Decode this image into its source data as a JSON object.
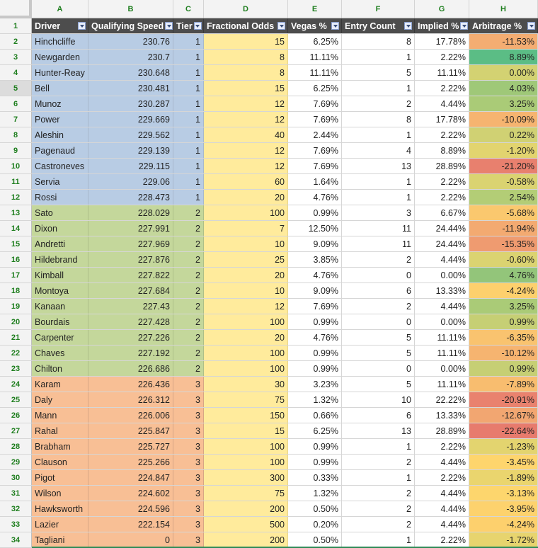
{
  "columns": [
    "A",
    "B",
    "C",
    "D",
    "E",
    "F",
    "G",
    "H"
  ],
  "headers": [
    "Driver",
    "Qualifying Speed",
    "Tier",
    "Fractional Odds",
    "Vegas %",
    "Entry Count",
    "Implied %",
    "Arbitrage %"
  ],
  "selected_row": 5,
  "tier_colors": {
    "1": "#b8cce4",
    "2": "#c4d79b",
    "3": "#f8bf95"
  },
  "odds_color": "#ffeb9c",
  "rows": [
    {
      "n": 2,
      "driver": "Hinchcliffe",
      "speed": "230.76",
      "tier": "1",
      "odds": "15",
      "vegas": "6.25%",
      "entry": "8",
      "implied": "17.78%",
      "arb": "-11.53%",
      "arb_color": "#f4ad72"
    },
    {
      "n": 3,
      "driver": "Newgarden",
      "speed": "230.7",
      "tier": "1",
      "odds": "8",
      "vegas": "11.11%",
      "entry": "1",
      "implied": "2.22%",
      "arb": "8.89%",
      "arb_color": "#5bbd85"
    },
    {
      "n": 4,
      "driver": "Hunter-Reay",
      "speed": "230.648",
      "tier": "1",
      "odds": "8",
      "vegas": "11.11%",
      "entry": "5",
      "implied": "11.11%",
      "arb": "0.00%",
      "arb_color": "#d3d272"
    },
    {
      "n": 5,
      "driver": "Bell",
      "speed": "230.481",
      "tier": "1",
      "odds": "15",
      "vegas": "6.25%",
      "entry": "1",
      "implied": "2.22%",
      "arb": "4.03%",
      "arb_color": "#9fc878"
    },
    {
      "n": 6,
      "driver": "Munoz",
      "speed": "230.287",
      "tier": "1",
      "odds": "12",
      "vegas": "7.69%",
      "entry": "2",
      "implied": "4.44%",
      "arb": "3.25%",
      "arb_color": "#aacb77"
    },
    {
      "n": 7,
      "driver": "Power",
      "speed": "229.669",
      "tier": "1",
      "odds": "12",
      "vegas": "7.69%",
      "entry": "8",
      "implied": "17.78%",
      "arb": "-10.09%",
      "arb_color": "#f6b470"
    },
    {
      "n": 8,
      "driver": "Aleshin",
      "speed": "229.562",
      "tier": "1",
      "odds": "40",
      "vegas": "2.44%",
      "entry": "1",
      "implied": "2.22%",
      "arb": "0.22%",
      "arb_color": "#d0d173"
    },
    {
      "n": 9,
      "driver": "Pagenaud",
      "speed": "229.139",
      "tier": "1",
      "odds": "12",
      "vegas": "7.69%",
      "entry": "4",
      "implied": "8.89%",
      "arb": "-1.20%",
      "arb_color": "#e2d46f"
    },
    {
      "n": 10,
      "driver": "Castroneves",
      "speed": "229.115",
      "tier": "1",
      "odds": "12",
      "vegas": "7.69%",
      "entry": "13",
      "implied": "28.89%",
      "arb": "-21.20%",
      "arb_color": "#e8806e"
    },
    {
      "n": 11,
      "driver": "Servia",
      "speed": "229.06",
      "tier": "1",
      "odds": "60",
      "vegas": "1.64%",
      "entry": "1",
      "implied": "2.22%",
      "arb": "-0.58%",
      "arb_color": "#dad371"
    },
    {
      "n": 12,
      "driver": "Rossi",
      "speed": "228.473",
      "tier": "1",
      "odds": "20",
      "vegas": "4.76%",
      "entry": "1",
      "implied": "2.22%",
      "arb": "2.54%",
      "arb_color": "#b3cd76"
    },
    {
      "n": 13,
      "driver": "Sato",
      "speed": "228.029",
      "tier": "2",
      "odds": "100",
      "vegas": "0.99%",
      "entry": "3",
      "implied": "6.67%",
      "arb": "-5.68%",
      "arb_color": "#fac86e"
    },
    {
      "n": 14,
      "driver": "Dixon",
      "speed": "227.991",
      "tier": "2",
      "odds": "7",
      "vegas": "12.50%",
      "entry": "11",
      "implied": "24.44%",
      "arb": "-11.94%",
      "arb_color": "#f3aa71"
    },
    {
      "n": 15,
      "driver": "Andretti",
      "speed": "227.969",
      "tier": "2",
      "odds": "10",
      "vegas": "9.09%",
      "entry": "11",
      "implied": "24.44%",
      "arb": "-15.35%",
      "arb_color": "#ef9b70"
    },
    {
      "n": 16,
      "driver": "Hildebrand",
      "speed": "227.876",
      "tier": "2",
      "odds": "25",
      "vegas": "3.85%",
      "entry": "2",
      "implied": "4.44%",
      "arb": "-0.60%",
      "arb_color": "#dbd371"
    },
    {
      "n": 17,
      "driver": "Kimball",
      "speed": "227.822",
      "tier": "2",
      "odds": "20",
      "vegas": "4.76%",
      "entry": "0",
      "implied": "0.00%",
      "arb": "4.76%",
      "arb_color": "#93c57a"
    },
    {
      "n": 18,
      "driver": "Montoya",
      "speed": "227.684",
      "tier": "2",
      "odds": "10",
      "vegas": "9.09%",
      "entry": "6",
      "implied": "13.33%",
      "arb": "-4.24%",
      "arb_color": "#fdd06d"
    },
    {
      "n": 19,
      "driver": "Kanaan",
      "speed": "227.43",
      "tier": "2",
      "odds": "12",
      "vegas": "7.69%",
      "entry": "2",
      "implied": "4.44%",
      "arb": "3.25%",
      "arb_color": "#aacb77"
    },
    {
      "n": 20,
      "driver": "Bourdais",
      "speed": "227.428",
      "tier": "2",
      "odds": "100",
      "vegas": "0.99%",
      "entry": "0",
      "implied": "0.00%",
      "arb": "0.99%",
      "arb_color": "#c6cf74"
    },
    {
      "n": 21,
      "driver": "Carpenter",
      "speed": "227.226",
      "tier": "2",
      "odds": "20",
      "vegas": "4.76%",
      "entry": "5",
      "implied": "11.11%",
      "arb": "-6.35%",
      "arb_color": "#f9c36f"
    },
    {
      "n": 22,
      "driver": "Chaves",
      "speed": "227.192",
      "tier": "2",
      "odds": "100",
      "vegas": "0.99%",
      "entry": "5",
      "implied": "11.11%",
      "arb": "-10.12%",
      "arb_color": "#f6b470"
    },
    {
      "n": 23,
      "driver": "Chilton",
      "speed": "226.686",
      "tier": "2",
      "odds": "100",
      "vegas": "0.99%",
      "entry": "0",
      "implied": "0.00%",
      "arb": "0.99%",
      "arb_color": "#c6cf74"
    },
    {
      "n": 24,
      "driver": "Karam",
      "speed": "226.436",
      "tier": "3",
      "odds": "30",
      "vegas": "3.23%",
      "entry": "5",
      "implied": "11.11%",
      "arb": "-7.89%",
      "arb_color": "#f8bd6f"
    },
    {
      "n": 25,
      "driver": "Daly",
      "speed": "226.312",
      "tier": "3",
      "odds": "75",
      "vegas": "1.32%",
      "entry": "10",
      "implied": "22.22%",
      "arb": "-20.91%",
      "arb_color": "#e9826e"
    },
    {
      "n": 26,
      "driver": "Mann",
      "speed": "226.006",
      "tier": "3",
      "odds": "150",
      "vegas": "0.66%",
      "entry": "6",
      "implied": "13.33%",
      "arb": "-12.67%",
      "arb_color": "#f2a671"
    },
    {
      "n": 27,
      "driver": "Rahal",
      "speed": "225.847",
      "tier": "3",
      "odds": "15",
      "vegas": "6.25%",
      "entry": "13",
      "implied": "28.89%",
      "arb": "-22.64%",
      "arb_color": "#e77b6d"
    },
    {
      "n": 28,
      "driver": "Brabham",
      "speed": "225.727",
      "tier": "3",
      "odds": "100",
      "vegas": "0.99%",
      "entry": "1",
      "implied": "2.22%",
      "arb": "-1.23%",
      "arb_color": "#e3d46f"
    },
    {
      "n": 29,
      "driver": "Clauson",
      "speed": "225.266",
      "tier": "3",
      "odds": "100",
      "vegas": "0.99%",
      "entry": "2",
      "implied": "4.44%",
      "arb": "-3.45%",
      "arb_color": "#fed56d"
    },
    {
      "n": 30,
      "driver": "Pigot",
      "speed": "224.847",
      "tier": "3",
      "odds": "300",
      "vegas": "0.33%",
      "entry": "1",
      "implied": "2.22%",
      "arb": "-1.89%",
      "arb_color": "#ead56e"
    },
    {
      "n": 31,
      "driver": "Wilson",
      "speed": "224.602",
      "tier": "3",
      "odds": "75",
      "vegas": "1.32%",
      "entry": "2",
      "implied": "4.44%",
      "arb": "-3.13%",
      "arb_color": "#fdd66d"
    },
    {
      "n": 32,
      "driver": "Hawksworth",
      "speed": "224.596",
      "tier": "3",
      "odds": "200",
      "vegas": "0.50%",
      "entry": "2",
      "implied": "4.44%",
      "arb": "-3.95%",
      "arb_color": "#fdd26d"
    },
    {
      "n": 33,
      "driver": "Lazier",
      "speed": "222.154",
      "tier": "3",
      "odds": "500",
      "vegas": "0.20%",
      "entry": "2",
      "implied": "4.44%",
      "arb": "-4.24%",
      "arb_color": "#fdd06d"
    },
    {
      "n": 34,
      "driver": "Tagliani",
      "speed": "0",
      "tier": "3",
      "odds": "200",
      "vegas": "0.50%",
      "entry": "1",
      "implied": "2.22%",
      "arb": "-1.72%",
      "arb_color": "#e7d46e"
    }
  ]
}
